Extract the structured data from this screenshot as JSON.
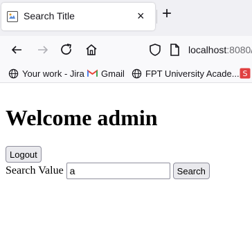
{
  "tab": {
    "title": "Search Title",
    "close_glyph": "×",
    "new_tab_glyph": "+"
  },
  "navbar": {
    "url_host": "localhost",
    "url_port": ":8080/"
  },
  "bookmarks": [
    {
      "label": "Your work - Jira",
      "icon": "globe-icon"
    },
    {
      "label": "Gmail",
      "icon": "gmail-icon"
    },
    {
      "label": "FPT University Acade...",
      "icon": "globe-icon"
    },
    {
      "label": "",
      "icon": "bookmark-favicon-icon"
    }
  ],
  "page": {
    "heading": "Welcome admin",
    "logout_label": "Logout",
    "search_label": "Search Value",
    "search_value": "a",
    "search_button_label": "Search"
  },
  "colors": {
    "tabstrip_bg": "#f0f0f4",
    "toolbar_bg": "#f9f9fb",
    "button_bg": "#e9e9ed",
    "gmail_red": "#ea4335"
  }
}
